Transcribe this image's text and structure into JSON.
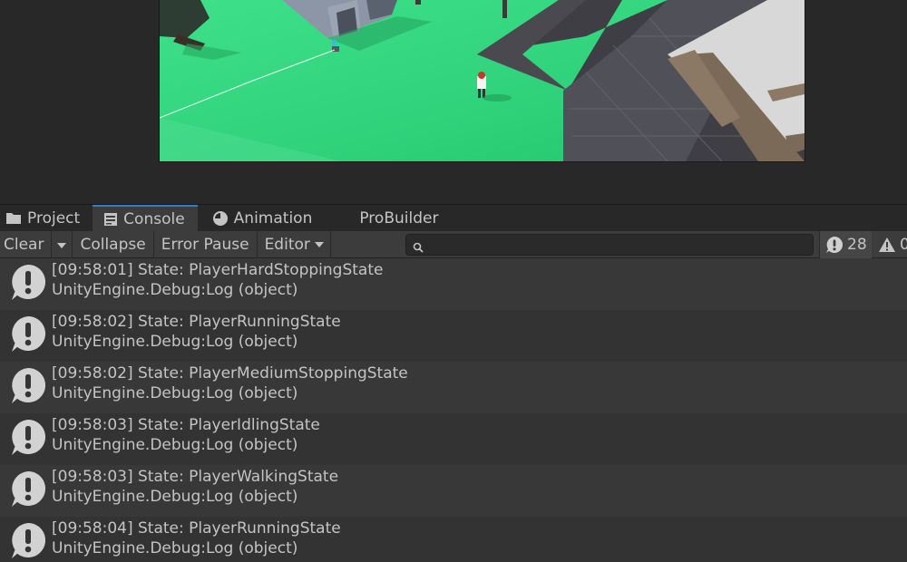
{
  "tabs": [
    {
      "label": "Project",
      "icon": "folder-icon"
    },
    {
      "label": "Console",
      "icon": "console-icon",
      "active": true
    },
    {
      "label": "Animation",
      "icon": "clock-icon"
    },
    {
      "label": "ProBuilder"
    }
  ],
  "toolbar": {
    "clear_label": "Clear",
    "collapse_label": "Collapse",
    "error_pause_label": "Error Pause",
    "editor_label": "Editor",
    "search_placeholder": "",
    "search_value": "",
    "info_count": "28",
    "warning_count": "0"
  },
  "logs": [
    {
      "message": "[09:58:01] State: PlayerHardStoppingState",
      "detail": "UnityEngine.Debug:Log (object)"
    },
    {
      "message": "[09:58:02] State: PlayerRunningState",
      "detail": "UnityEngine.Debug:Log (object)"
    },
    {
      "message": "[09:58:02] State: PlayerMediumStoppingState",
      "detail": "UnityEngine.Debug:Log (object)"
    },
    {
      "message": "[09:58:03] State: PlayerIdlingState",
      "detail": "UnityEngine.Debug:Log (object)"
    },
    {
      "message": "[09:58:03] State: PlayerWalkingState",
      "detail": "UnityEngine.Debug:Log (object)"
    },
    {
      "message": "[09:58:04] State: PlayerRunningState",
      "detail": "UnityEngine.Debug:Log (object)"
    }
  ],
  "colors": {
    "accent": "#3a79bb",
    "ground": "#2fcf77",
    "panel": "#3c3c3c"
  }
}
